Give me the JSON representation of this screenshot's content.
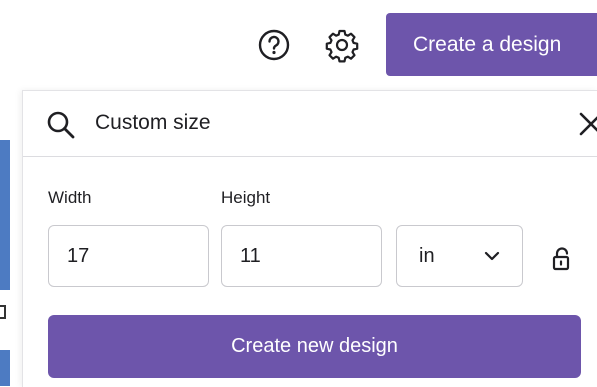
{
  "header": {
    "help_icon": "help-circle-icon",
    "settings_icon": "gear-icon",
    "create_label": "Create a design"
  },
  "popover": {
    "search": {
      "value": "Custom size",
      "search_icon": "search-icon",
      "close_icon": "close-icon"
    },
    "width_label": "Width",
    "height_label": "Height",
    "width_value": "17",
    "height_value": "11",
    "unit": {
      "selected": "in",
      "icon": "chevron-down-icon"
    },
    "lock_icon": "unlocked-padlock-icon",
    "create_button_label": "Create new design"
  },
  "colors": {
    "accent": "#6d55ab",
    "border": "#c9c9ce",
    "text": "#1f1f23"
  }
}
